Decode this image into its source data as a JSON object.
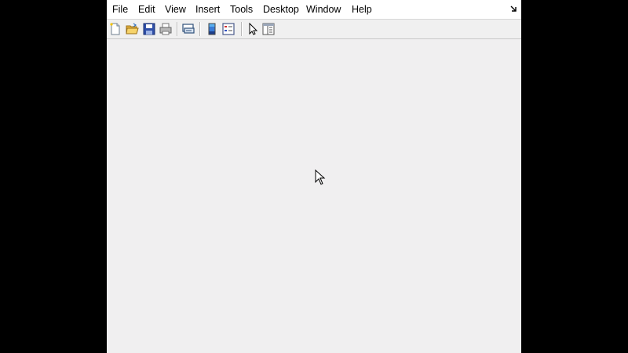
{
  "menubar": {
    "items": [
      {
        "label": "File"
      },
      {
        "label": "Edit"
      },
      {
        "label": "View"
      },
      {
        "label": "Insert"
      },
      {
        "label": "Tools"
      },
      {
        "label": "Desktop"
      },
      {
        "label": "Window"
      },
      {
        "label": "Help"
      }
    ],
    "dock_icon": "dock-arrow-icon"
  },
  "toolbar": {
    "buttons": [
      {
        "icon": "new-figure-icon"
      },
      {
        "icon": "open-file-icon"
      },
      {
        "icon": "save-figure-icon"
      },
      {
        "icon": "print-figure-icon"
      },
      {
        "icon": "link-plot-icon"
      },
      {
        "icon": "insert-colorbar-icon"
      },
      {
        "icon": "insert-legend-icon"
      },
      {
        "icon": "edit-plot-icon"
      },
      {
        "icon": "show-plot-tools-icon"
      }
    ]
  },
  "colors": {
    "background": "#000000",
    "window": "#f0f0f0",
    "menubar": "#ffffff"
  }
}
